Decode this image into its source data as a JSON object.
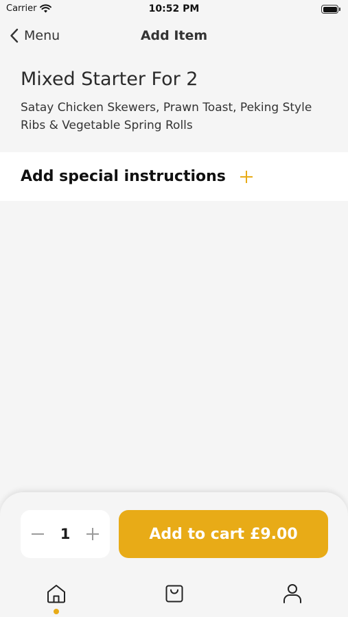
{
  "status_bar": {
    "carrier": "Carrier",
    "time": "10:52 PM"
  },
  "nav": {
    "back_label": "Menu",
    "title": "Add Item"
  },
  "item": {
    "name": "Mixed Starter For 2",
    "description": "Satay Chicken Skewers, Prawn Toast, Peking Style Ribs & Vegetable Spring Rolls"
  },
  "instructions": {
    "label": "Add special instructions"
  },
  "cart": {
    "quantity": "1",
    "button_label": "Add to cart",
    "price": "£9.00"
  },
  "tabs": [
    {
      "icon": "home-icon",
      "active": true
    },
    {
      "icon": "shopping-bag-icon",
      "active": false
    },
    {
      "icon": "user-icon",
      "active": false
    }
  ],
  "colors": {
    "accent": "#e8ab17",
    "background": "#f5f5f5",
    "card": "#ffffff",
    "text": "#1c1c1c"
  }
}
